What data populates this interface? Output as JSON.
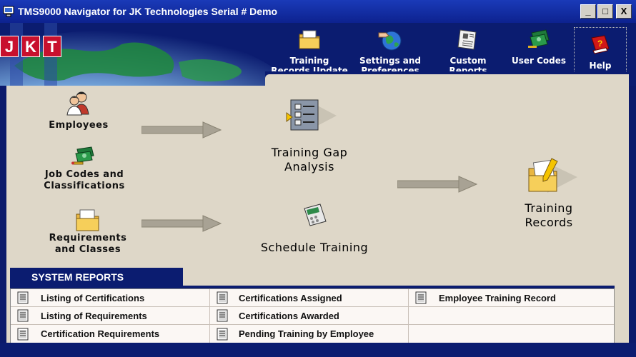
{
  "window": {
    "title": "TMS9000 Navigator for JK Technologies  Serial # Demo",
    "controls": {
      "minimize": "_",
      "maximize": "□",
      "close": "X"
    }
  },
  "brand": {
    "letters": [
      "J",
      "K",
      "T"
    ]
  },
  "toolbar": {
    "items": [
      {
        "line1": "Training",
        "line2": "Records Update",
        "icon": "folder-icon"
      },
      {
        "line1": "Settings and",
        "line2": "Preferences",
        "icon": "globe-hand-icon"
      },
      {
        "line1": "Custom",
        "line2": "Reports",
        "icon": "newspaper-icon"
      },
      {
        "line1": "User Codes",
        "line2": "",
        "icon": "money-icon"
      },
      {
        "line1": "Help",
        "line2": "",
        "icon": "help-book-icon"
      }
    ]
  },
  "workflow": {
    "employees": "Employees",
    "job_codes": {
      "line1": "Job Codes and",
      "line2": "Classifications"
    },
    "requirements": {
      "line1": "Requirements",
      "line2": "and Classes"
    },
    "gap_analysis": {
      "line1": "Training Gap",
      "line2": "Analysis"
    },
    "schedule": "Schedule Training",
    "records": {
      "line1": "Training",
      "line2": "Records"
    }
  },
  "reports": {
    "tab_label": "SYSTEM REPORTS",
    "col1": [
      "Listing of Certifications",
      "Listing of Requirements",
      "Certification Requirements"
    ],
    "col2": [
      "Certifications Assigned",
      "Certifications Awarded",
      "Pending Training by Employee"
    ],
    "col3": [
      "Employee Training Record",
      "",
      ""
    ]
  },
  "colors": {
    "navy": "#0b1c70",
    "panel": "#ded7c8",
    "brand_red": "#c8102e"
  }
}
